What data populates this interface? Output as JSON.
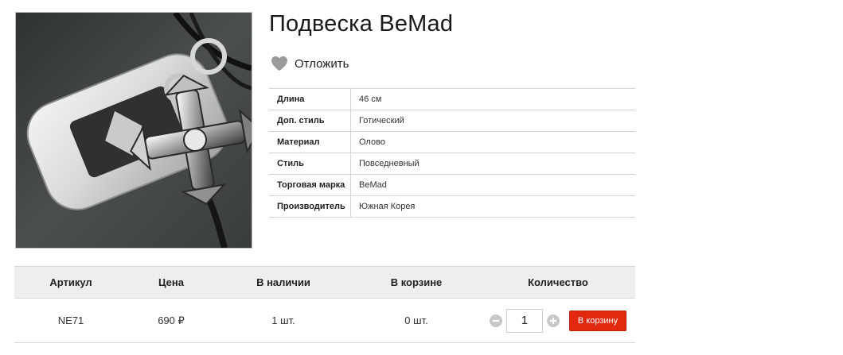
{
  "product": {
    "title": "Подвеска BeMad",
    "image_icon": "pendant-photo",
    "wishlist_icon": "heart-icon",
    "wishlist_label": "Отложить"
  },
  "specs": [
    {
      "key": "Длина",
      "value": "46 см"
    },
    {
      "key": "Доп. стиль",
      "value": "Готический"
    },
    {
      "key": "Материал",
      "value": "Олово"
    },
    {
      "key": "Стиль",
      "value": "Повседневный"
    },
    {
      "key": "Торговая марка",
      "value": "BeMad"
    },
    {
      "key": "Производитель",
      "value": "Южная Корея"
    }
  ],
  "purchase": {
    "headers": {
      "sku": "Артикул",
      "price": "Цена",
      "stock": "В наличии",
      "in_cart": "В корзине",
      "quantity": "Количество"
    },
    "row": {
      "sku": "NE71",
      "price": "690 ₽",
      "stock": "1 шт.",
      "in_cart": "0 шт.",
      "quantity": "1"
    },
    "add_to_cart_label": "В корзину",
    "colors": {
      "button": "#e2280f",
      "header_bg": "#eeeeee"
    }
  }
}
